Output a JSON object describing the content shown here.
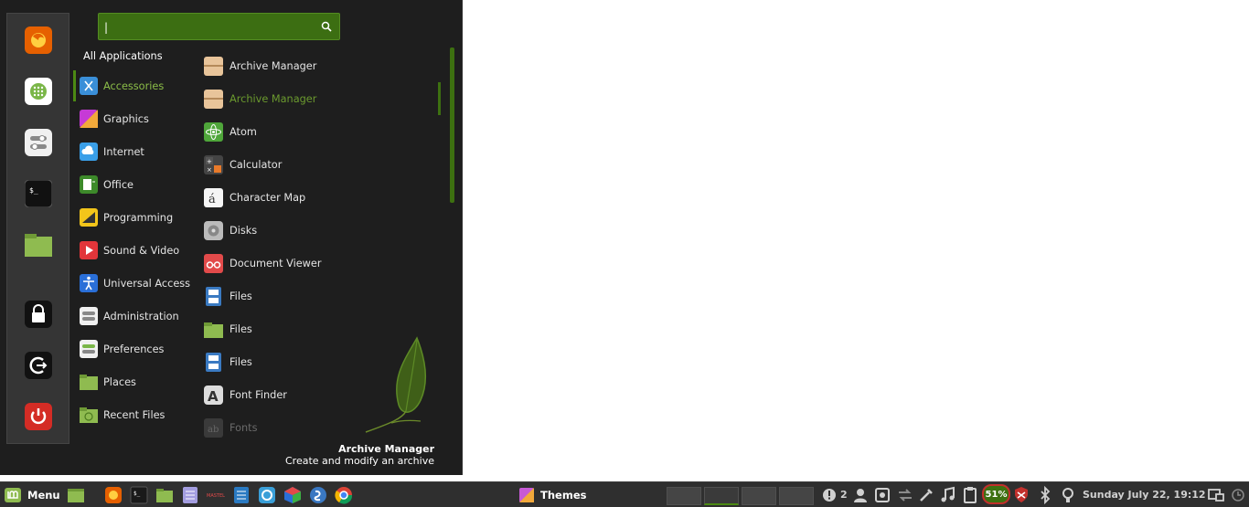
{
  "favorites": [
    {
      "name": "firefox-icon",
      "color": "#e66000"
    },
    {
      "name": "software-manager-icon",
      "color": "#7ab648"
    },
    {
      "name": "system-settings-icon",
      "color": "#9e9e9e"
    },
    {
      "name": "terminal-icon",
      "color": "#2b2b2b"
    },
    {
      "name": "files-icon",
      "color": "#8fbb50"
    },
    {
      "name": "lock-screen-icon",
      "color": "#2b2b2b"
    },
    {
      "name": "logout-icon",
      "color": "#2b2b2b"
    },
    {
      "name": "shutdown-icon",
      "color": "#d42c25"
    }
  ],
  "search": {
    "value": "|",
    "placeholder": ""
  },
  "categories_header": "All Applications",
  "categories": [
    {
      "label": "Accessories",
      "icon": "accessories-icon",
      "active": true
    },
    {
      "label": "Graphics",
      "icon": "graphics-icon"
    },
    {
      "label": "Internet",
      "icon": "internet-icon"
    },
    {
      "label": "Office",
      "icon": "office-icon"
    },
    {
      "label": "Programming",
      "icon": "programming-icon"
    },
    {
      "label": "Sound & Video",
      "icon": "sound-video-icon"
    },
    {
      "label": "Universal Access",
      "icon": "universal-access-icon"
    },
    {
      "label": "Administration",
      "icon": "administration-icon"
    },
    {
      "label": "Preferences",
      "icon": "preferences-icon"
    },
    {
      "label": "Places",
      "icon": "places-icon"
    },
    {
      "label": "Recent Files",
      "icon": "recent-files-icon"
    }
  ],
  "apps": [
    {
      "label": "Archive Manager",
      "icon": "archive-manager-icon"
    },
    {
      "label": "Archive Manager",
      "icon": "archive-manager-icon",
      "highlight": true
    },
    {
      "label": "Atom",
      "icon": "atom-icon"
    },
    {
      "label": "Calculator",
      "icon": "calculator-icon"
    },
    {
      "label": "Character Map",
      "icon": "character-map-icon"
    },
    {
      "label": "Disks",
      "icon": "disks-icon"
    },
    {
      "label": "Document Viewer",
      "icon": "document-viewer-icon"
    },
    {
      "label": "Files",
      "icon": "files-blue-icon"
    },
    {
      "label": "Files",
      "icon": "files-green-icon"
    },
    {
      "label": "Files",
      "icon": "files-blue-icon"
    },
    {
      "label": "Font Finder",
      "icon": "font-finder-icon"
    },
    {
      "label": "Fonts",
      "icon": "fonts-icon",
      "dim": true
    }
  ],
  "info": {
    "title": "Archive Manager",
    "description": "Create and modify an archive"
  },
  "panel": {
    "menu_label": "Menu",
    "window_title": "Themes",
    "notification_count": "2",
    "battery": "51%",
    "clock": "Sunday July 22, 19:12"
  },
  "colors": {
    "accent": "#4c8a13",
    "menu_bg": "#1e1e1e",
    "panel_bg": "#2f2f2f"
  }
}
